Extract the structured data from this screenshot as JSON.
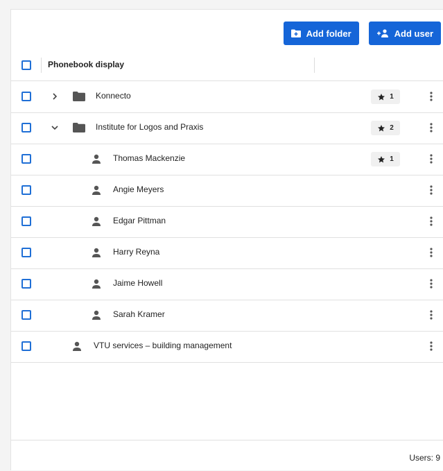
{
  "toolbar": {
    "add_folder_label": "Add folder",
    "add_user_label": "Add user",
    "accent": "#1565d8"
  },
  "table": {
    "column_header": "Phonebook display"
  },
  "rows": [
    {
      "type": "folder",
      "expanded": false,
      "level": 0,
      "label": "Konnecto",
      "badge": "1"
    },
    {
      "type": "folder",
      "expanded": true,
      "level": 0,
      "label": "Institute for Logos and Praxis",
      "badge": "2"
    },
    {
      "type": "user",
      "level": 1,
      "label": "Thomas Mackenzie",
      "badge": "1"
    },
    {
      "type": "user",
      "level": 1,
      "label": "Angie Meyers"
    },
    {
      "type": "user",
      "level": 1,
      "label": "Edgar Pittman"
    },
    {
      "type": "user",
      "level": 1,
      "label": "Harry Reyna"
    },
    {
      "type": "user",
      "level": 1,
      "label": "Jaime Howell"
    },
    {
      "type": "user",
      "level": 1,
      "label": "Sarah Kramer"
    },
    {
      "type": "user",
      "level": 0,
      "label": "VTU services – building management"
    }
  ],
  "footer": {
    "users_count_text": "Users: 9"
  }
}
